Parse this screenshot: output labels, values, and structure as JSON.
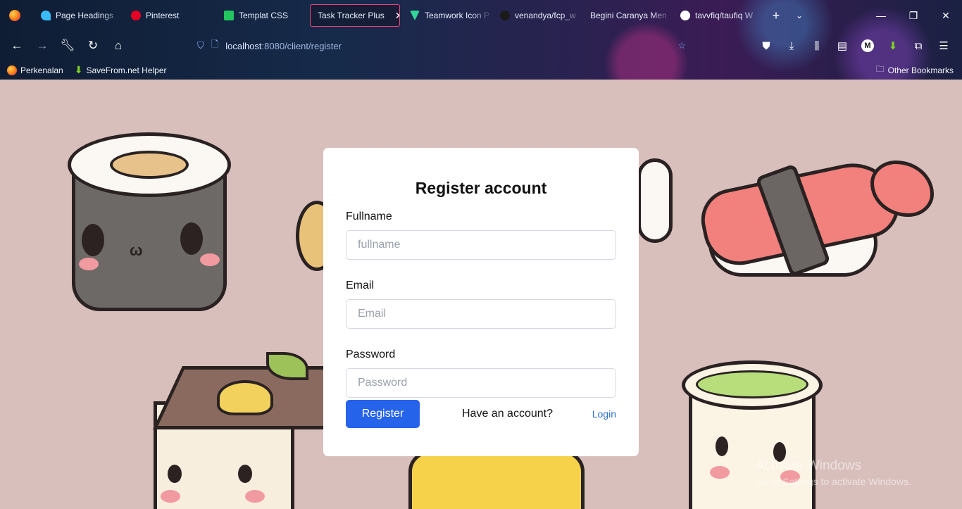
{
  "browser": {
    "tabs": [
      {
        "label": "Page Headings",
        "icon": "tailwind-icon",
        "color": "#38bdf8"
      },
      {
        "label": "Pinterest",
        "icon": "pinterest-icon",
        "color": "#e60023"
      },
      {
        "label": "Templat CSS",
        "icon": "w-logo-icon",
        "color": "#22c55e"
      },
      {
        "label": "Task Tracker Plus",
        "icon": "",
        "color": "",
        "active": true
      },
      {
        "label": "Teamwork Icon P",
        "icon": "teamwork-icon",
        "color": "#34d399"
      },
      {
        "label": "venandya/fcp_w",
        "icon": "github-icon",
        "color": "#ffffff"
      },
      {
        "label": "Begini Caranya Men",
        "icon": "page-icon",
        "color": "#a0a0a0"
      },
      {
        "label": "tavvfiq/taufiq W",
        "icon": "github-icon",
        "color": "#ffffff"
      }
    ],
    "url": {
      "host": "localhost",
      "rest": ":8080/client/register",
      "prefix": "lo"
    },
    "bookmarks": [
      {
        "label": "Perkenalan",
        "icon": "firefox-icon"
      },
      {
        "label": "SaveFrom.net Helper",
        "icon": "download-arrow-icon"
      }
    ],
    "other_bookmarks": "Other Bookmarks"
  },
  "form": {
    "title": "Register account",
    "fullname": {
      "label": "Fullname",
      "placeholder": "fullname",
      "value": ""
    },
    "email": {
      "label": "Email",
      "placeholder": "Email",
      "value": ""
    },
    "password": {
      "label": "Password",
      "placeholder": "Password",
      "value": ""
    },
    "register_label": "Register",
    "have_account": "Have an account?",
    "login_label": "Login"
  },
  "watermark": {
    "line1": "Activate Windows",
    "line2": "Go to Settings to activate Windows."
  },
  "colors": {
    "page_bg": "#d8bfbc",
    "primary": "#2563eb",
    "link": "#2a6fd6"
  }
}
